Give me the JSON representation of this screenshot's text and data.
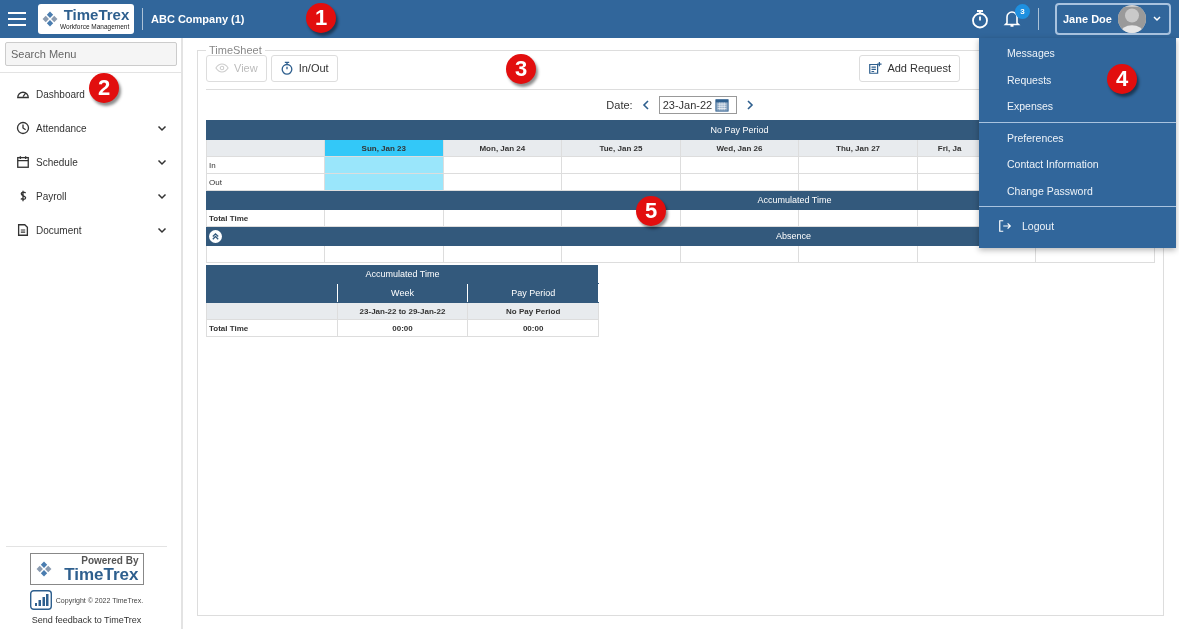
{
  "header": {
    "logo": {
      "name": "TimeTrex",
      "tagline": "Workforce Management"
    },
    "company": "ABC Company (1)",
    "notifications": {
      "count": "3"
    },
    "user": {
      "name": "Jane Doe",
      "expanded": true
    }
  },
  "user_menu": [
    {
      "items": [
        {
          "label": "Messages",
          "kind": "item"
        },
        {
          "label": "Requests",
          "kind": "item"
        },
        {
          "label": "Expenses",
          "kind": "item"
        }
      ]
    },
    {
      "items": [
        {
          "label": "Preferences",
          "kind": "item"
        },
        {
          "label": "Contact Information",
          "kind": "item"
        },
        {
          "label": "Change Password",
          "kind": "item"
        }
      ]
    },
    {
      "items": [
        {
          "label": "Logout",
          "kind": "logout"
        }
      ]
    }
  ],
  "sidebar": {
    "search": {
      "placeholder": "Search Menu"
    },
    "items": [
      {
        "label": "Dashboard",
        "expandable": false
      },
      {
        "label": "Attendance",
        "expandable": true,
        "expanded": false
      },
      {
        "label": "Schedule",
        "expandable": true,
        "expanded": false
      },
      {
        "label": "Payroll",
        "expandable": true,
        "expanded": false
      },
      {
        "label": "Document",
        "expandable": true,
        "expanded": false
      }
    ],
    "footer": {
      "powered_by": "Powered By",
      "brand": "TimeTrex",
      "copyright": "Copyright © 2022 TimeTrex.",
      "feedback": "Send feedback to TimeTrex"
    }
  },
  "timesheet": {
    "title": "TimeSheet",
    "toolbar_left": [
      {
        "label": "View",
        "disabled": true
      },
      {
        "label": "In/Out",
        "disabled": false
      }
    ],
    "toolbar_right": [
      {
        "label": "Add Request",
        "disabled": false
      }
    ],
    "date": {
      "label": "Date:",
      "value": "23-Jan-22"
    },
    "pay_period": "No Pay Period",
    "days": [
      {
        "label": "Sun, Jan 23",
        "selected": true
      },
      {
        "label": "Mon, Jan 24",
        "selected": false
      },
      {
        "label": "Tue, Jan 25",
        "selected": false
      },
      {
        "label": "Wed, Jan 26",
        "selected": false
      },
      {
        "label": "Thu, Jan 27",
        "selected": false
      },
      {
        "label": "Fri, Ja",
        "selected": false
      }
    ],
    "rows": [
      "In",
      "Out"
    ],
    "accumulated_title": "Accumulated Time",
    "total_label": "Total Time",
    "absence": {
      "title": "Absence",
      "collapsed": false
    }
  },
  "summary": {
    "title": "Accumulated Time",
    "columns": [
      "Week",
      "Pay Period"
    ],
    "ranges": [
      "23-Jan-22 to 29-Jan-22",
      "No Pay Period"
    ],
    "row": {
      "label": "Total Time",
      "values": [
        "00:00",
        "00:00"
      ]
    }
  },
  "callouts": [
    "1",
    "2",
    "3",
    "4",
    "5"
  ]
}
